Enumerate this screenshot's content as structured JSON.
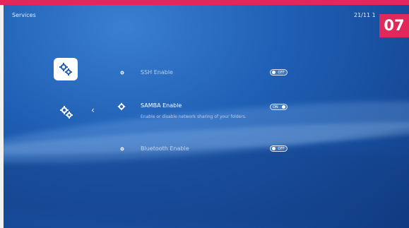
{
  "header": {
    "title": "Services",
    "date": "21/11 1"
  },
  "badge": "07",
  "category": {
    "selected_icon": "gears-icon",
    "back_icon": "chevron-left-icon"
  },
  "items": [
    {
      "label": "SSH Enable",
      "icon": "gear-icon",
      "toggle": "OFF",
      "description": ""
    },
    {
      "label": "SAMBA Enable",
      "icon": "gear-icon",
      "toggle": "ON",
      "description": "Enable or disable network sharing of your folders."
    },
    {
      "label": "Bluetooth Enable",
      "icon": "gear-icon",
      "toggle": "OFF",
      "description": ""
    }
  ],
  "colors": {
    "accent": "#e0285a",
    "background": "#1f5fb5"
  }
}
